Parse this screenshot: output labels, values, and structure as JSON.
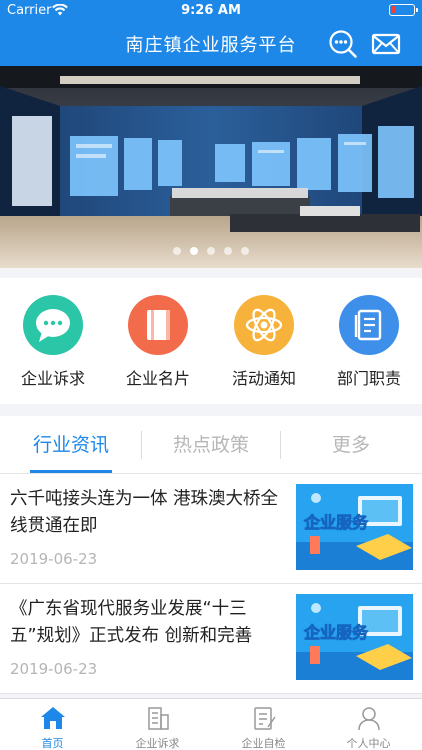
{
  "status_bar": {
    "carrier": "Carrier",
    "time": "9:26 AM",
    "battery_level": 0.18
  },
  "header": {
    "title": "南庄镇企业服务平台",
    "search_icon": "search-chat-icon",
    "mail_icon": "mail-icon"
  },
  "banner": {
    "slide_count": 5,
    "active_index": 1
  },
  "quick_actions": [
    {
      "label": "企业诉求",
      "icon": "chat-bubble-icon",
      "color": "#2bc6a8"
    },
    {
      "label": "企业名片",
      "icon": "card-icon",
      "color": "#f26b4a"
    },
    {
      "label": "活动通知",
      "icon": "atom-icon",
      "color": "#f6b23a"
    },
    {
      "label": "部门职责",
      "icon": "document-icon",
      "color": "#3d8fea"
    }
  ],
  "tabs": [
    {
      "label": "行业资讯",
      "active": true
    },
    {
      "label": "热点政策",
      "active": false
    },
    {
      "label": "更多",
      "active": false
    }
  ],
  "news": [
    {
      "title": "六千吨接头连为一体 港珠澳大桥全线贯通在即",
      "date": "2019-06-23",
      "thumb_text": "企业服务"
    },
    {
      "title": "《广东省现代服务业发展“十三五”规划》正式发布 创新和完善科…",
      "date": "2019-06-23",
      "thumb_text": "企业服务"
    }
  ],
  "tabbar": [
    {
      "label": "首页",
      "icon": "home-icon",
      "active": true
    },
    {
      "label": "企业诉求",
      "icon": "building-icon",
      "active": false
    },
    {
      "label": "企业自检",
      "icon": "checklist-icon",
      "active": false
    },
    {
      "label": "个人中心",
      "icon": "person-icon",
      "active": false
    }
  ],
  "colors": {
    "primary": "#1e88e8",
    "inactive_text": "#b7b7b7",
    "date_text": "#b5b5b5"
  }
}
